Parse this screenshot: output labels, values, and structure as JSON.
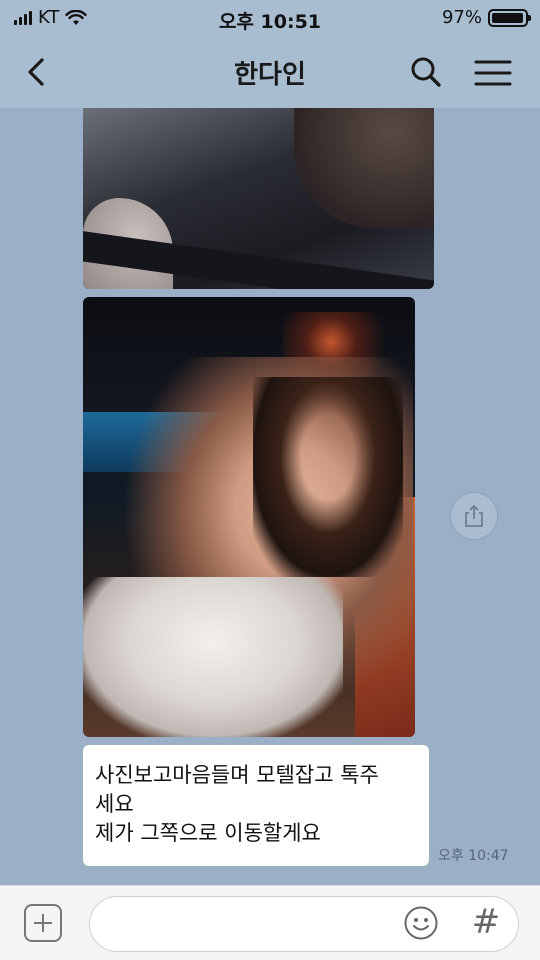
{
  "status_bar": {
    "carrier": "KT",
    "time": "오후 10:51",
    "battery": "97%",
    "battery_level": 0.97
  },
  "header": {
    "title": "한다인",
    "back_icon": "chevron-left-icon",
    "search_icon": "search-icon",
    "menu_icon": "hamburger-menu-icon"
  },
  "messages": [
    {
      "type": "image",
      "description": "photo"
    },
    {
      "type": "image",
      "description": "photo"
    },
    {
      "type": "text",
      "text": "사진보고마음들며 모텔잡고 톡주\n세요\n제가 그쪽으로 이동할게요",
      "time": "오후 10:47"
    }
  ],
  "share_icon": "share-icon",
  "input_bar": {
    "plus_icon": "plus-icon",
    "placeholder": "",
    "emoji_icon": "emoji-icon",
    "hash_label": "#"
  },
  "colors": {
    "chat_background": "#9bb0c6",
    "header_background": "#a9bdd1",
    "bubble": "#ffffff"
  }
}
